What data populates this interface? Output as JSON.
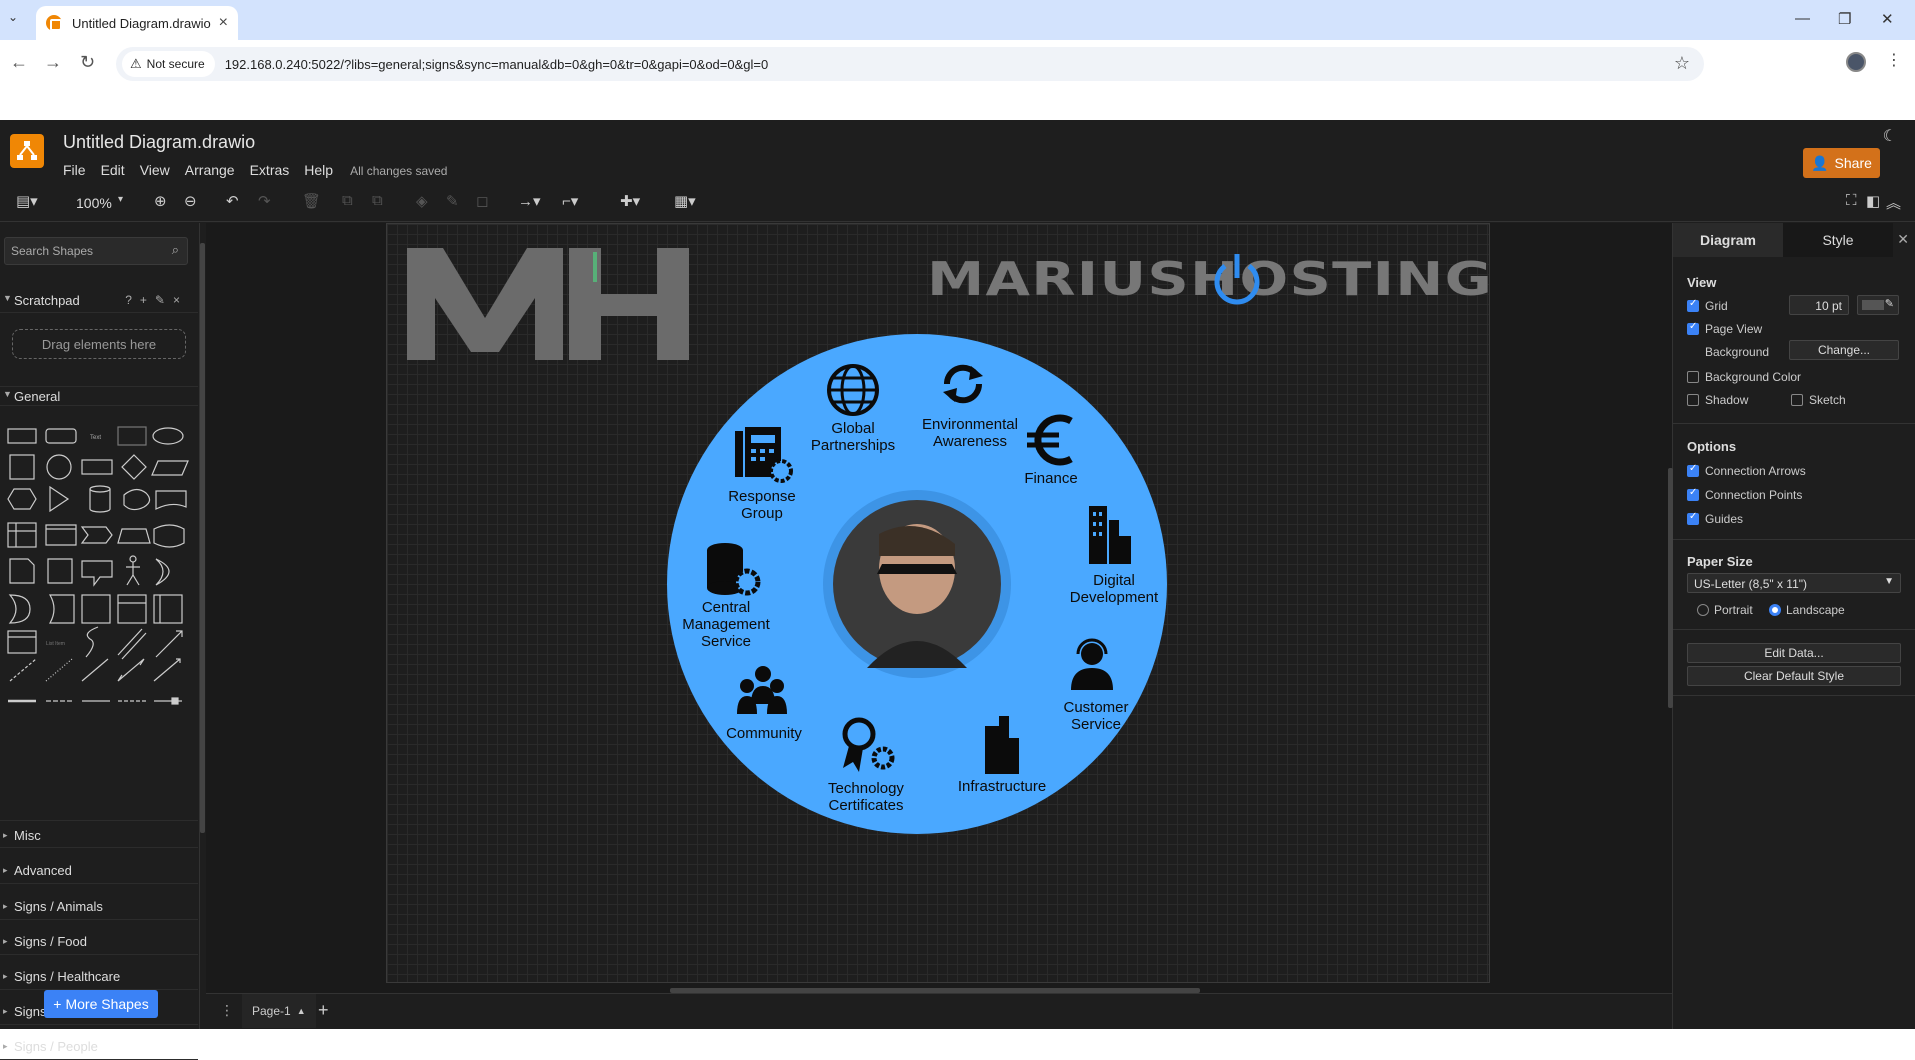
{
  "browser": {
    "tab_title": "Untitled Diagram.drawio",
    "security": "Not secure",
    "url": "192.168.0.240:5022/?libs=general;signs&sync=manual&db=0&gh=0&tr=0&gapi=0&od=0&gl=0"
  },
  "app": {
    "doc_title": "Untitled Diagram.drawio",
    "menu": [
      "File",
      "Edit",
      "View",
      "Arrange",
      "Extras",
      "Help"
    ],
    "save_status": "All changes saved",
    "share_label": "Share",
    "zoom": "100%"
  },
  "sidebar": {
    "search_placeholder": "Search Shapes",
    "scratchpad": "Scratchpad",
    "drop_hint": "Drag elements here",
    "general": "General",
    "sections": [
      "Misc",
      "Advanced",
      "Signs / Animals",
      "Signs / Food",
      "Signs / Healthcare",
      "Signs / Nature",
      "Signs / People"
    ],
    "more_shapes": "More Shapes"
  },
  "diagram": {
    "logo_text": "MARIUSHOSTING",
    "center_color": "#4aa8ff",
    "segments": {
      "global": "Global Partnerships",
      "environmental": "Environmental Awareness",
      "finance": "Finance",
      "digital": "Digital Development",
      "customer": "Customer Service",
      "infrastructure": "Infrastructure",
      "technology": "Technology Certificates",
      "community": "Community",
      "central": "Central Management Service",
      "response": "Response Group"
    }
  },
  "pages": {
    "current": "Page-1"
  },
  "panel": {
    "tab_diagram": "Diagram",
    "tab_style": "Style",
    "view": "View",
    "grid": "Grid",
    "grid_size": "10 pt",
    "page_view": "Page View",
    "background": "Background",
    "change": "Change...",
    "background_color": "Background Color",
    "shadow": "Shadow",
    "sketch": "Sketch",
    "options": "Options",
    "connection_arrows": "Connection Arrows",
    "connection_points": "Connection Points",
    "guides": "Guides",
    "paper_size": "Paper Size",
    "paper_value": "US-Letter (8,5\" x 11\")",
    "portrait": "Portrait",
    "landscape": "Landscape",
    "edit_data": "Edit Data...",
    "clear_style": "Clear Default Style"
  }
}
